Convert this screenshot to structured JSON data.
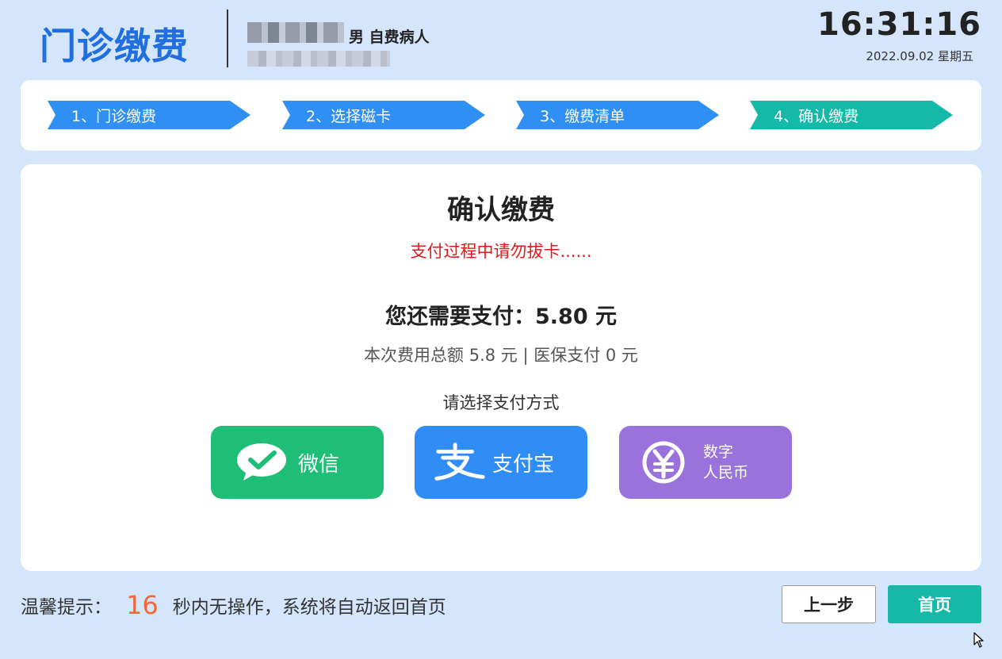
{
  "header": {
    "title": "门诊缴费",
    "patient_info": "男 自费病人",
    "time": "16:31:16",
    "date": "2022.09.02 星期五"
  },
  "steps": [
    {
      "label": "1、门诊缴费",
      "active": false
    },
    {
      "label": "2、选择磁卡",
      "active": false
    },
    {
      "label": "3、缴费清单",
      "active": false
    },
    {
      "label": "4、确认缴费",
      "active": true
    }
  ],
  "main": {
    "title": "确认缴费",
    "warning": "支付过程中请勿拔卡......",
    "amount_due": "您还需要支付：5.80 元",
    "fee_summary": "本次费用总额 5.8 元 | 医保支付 0 元",
    "choose_label": "请选择支付方式",
    "payment_methods": {
      "wechat": {
        "label": "微信",
        "color": "#1fbe76"
      },
      "alipay": {
        "label": "支付宝",
        "color": "#2f8df5"
      },
      "ecny": {
        "line1": "数字",
        "line2": "人民币",
        "color": "#9a72dc"
      }
    }
  },
  "footer": {
    "tip_prefix": "温馨提示：",
    "countdown": "16",
    "tip_suffix": "秒内无操作，系统将自动返回首页",
    "back_label": "上一步",
    "home_label": "首页"
  },
  "colors": {
    "background": "#d5e5fb",
    "accent_blue": "#2f8ff3",
    "accent_teal": "#14b9a7",
    "warning_red": "#e01a1a",
    "countdown_orange": "#f2663a"
  }
}
